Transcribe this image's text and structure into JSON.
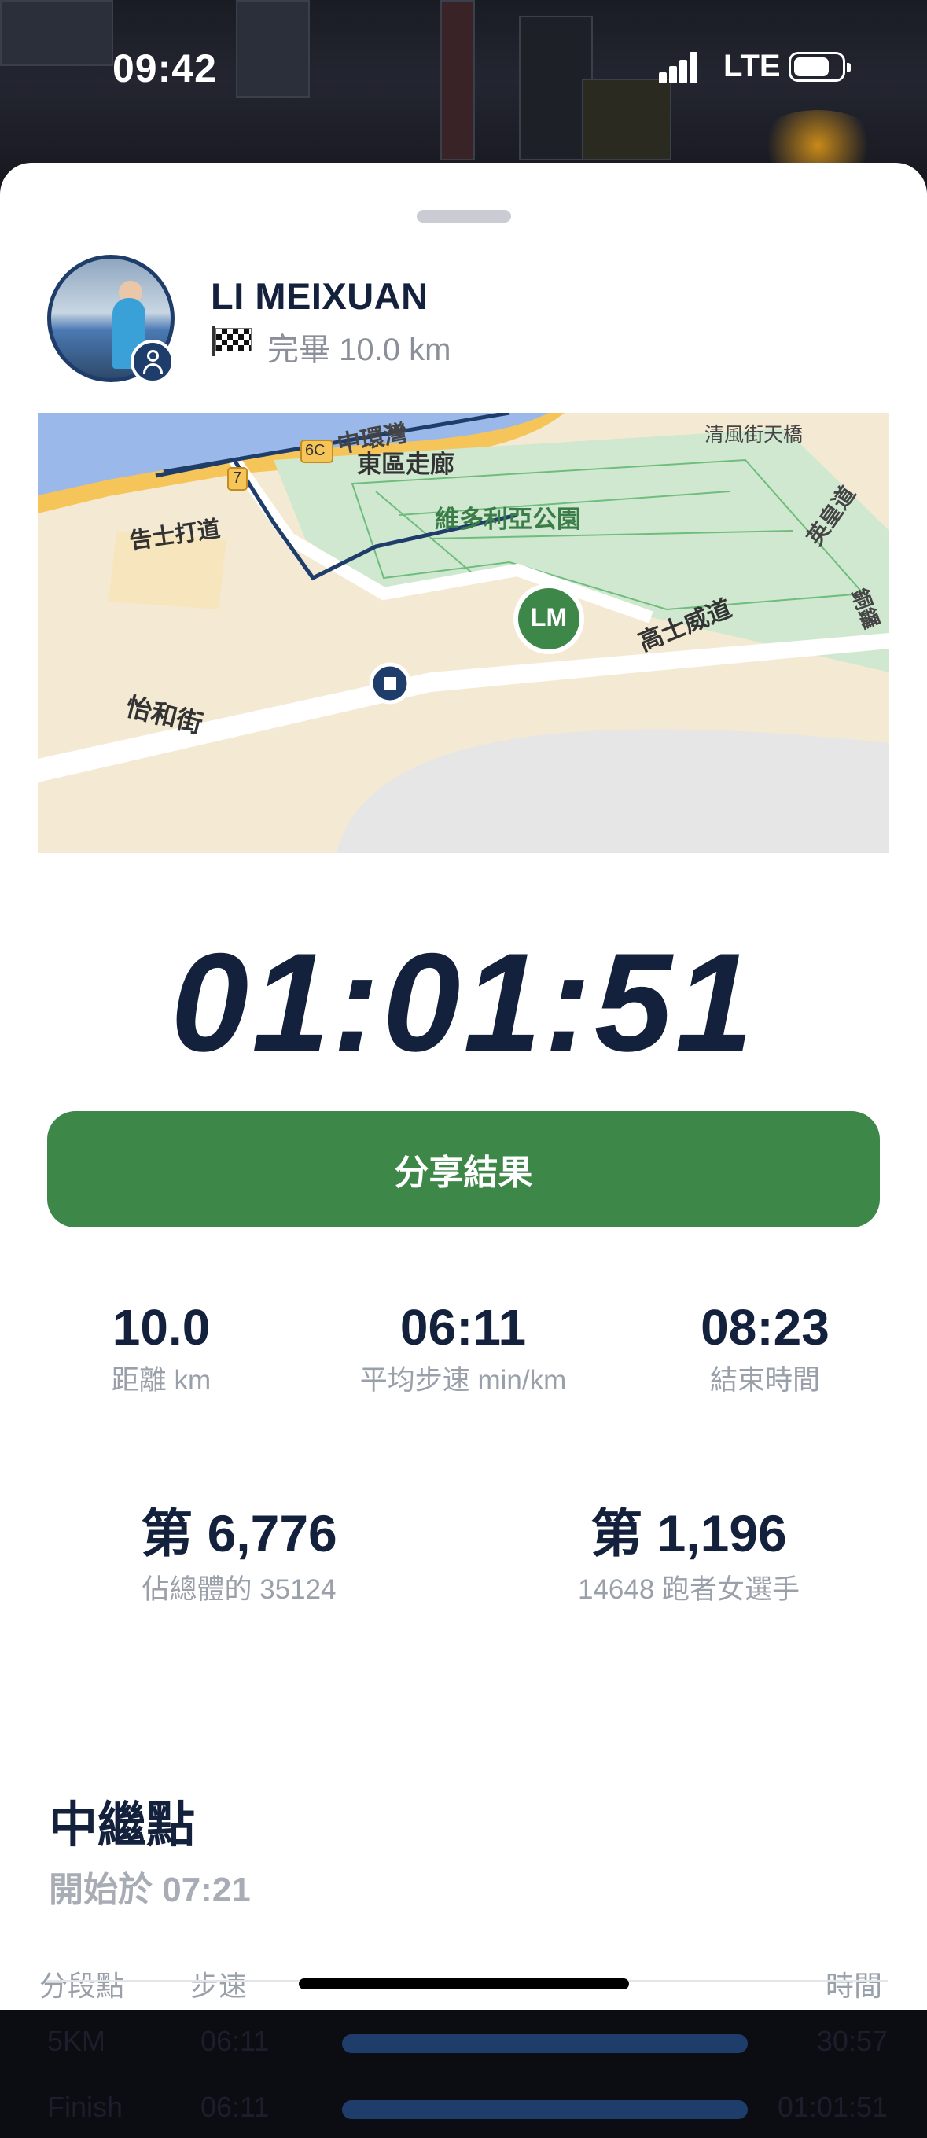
{
  "status_bar": {
    "time": "09:42",
    "network": "LTE"
  },
  "profile": {
    "name": "LI MEIXUAN",
    "status": "完畢 10.0 km"
  },
  "map": {
    "labels": {
      "road1": "中環灣",
      "road2": "東區走廊",
      "road3": "告士打道",
      "park": "維多利亞公園",
      "road4": "清風街天橋",
      "road5": "英皇道",
      "road6": "高士威道",
      "road7": "怡和街",
      "road8": "銅鑼",
      "exit1": "6C",
      "exit2": "7"
    },
    "runner_marker": "LM"
  },
  "finish_time": "01:01:51",
  "share_button": "分享結果",
  "stats": [
    {
      "value": "10.0",
      "label": "距離 km"
    },
    {
      "value": "06:11",
      "label": "平均步速 min/km"
    },
    {
      "value": "08:23",
      "label": "結束時間"
    }
  ],
  "ranks": [
    {
      "value": "第 6,776",
      "label": "佔總體的 35124"
    },
    {
      "value": "第 1,196",
      "label": "14648 跑者女選手"
    }
  ],
  "relay": {
    "title": "中繼點",
    "start": "開始於 07:21",
    "headers": {
      "split": "分段點",
      "pace": "步速",
      "time": "時間"
    },
    "rows": [
      {
        "split": "5KM",
        "pace": "06:11",
        "time": "30:57",
        "progress": 1.0
      },
      {
        "split": "Finish",
        "pace": "06:11",
        "time": "01:01:51",
        "progress": 1.0
      }
    ]
  }
}
